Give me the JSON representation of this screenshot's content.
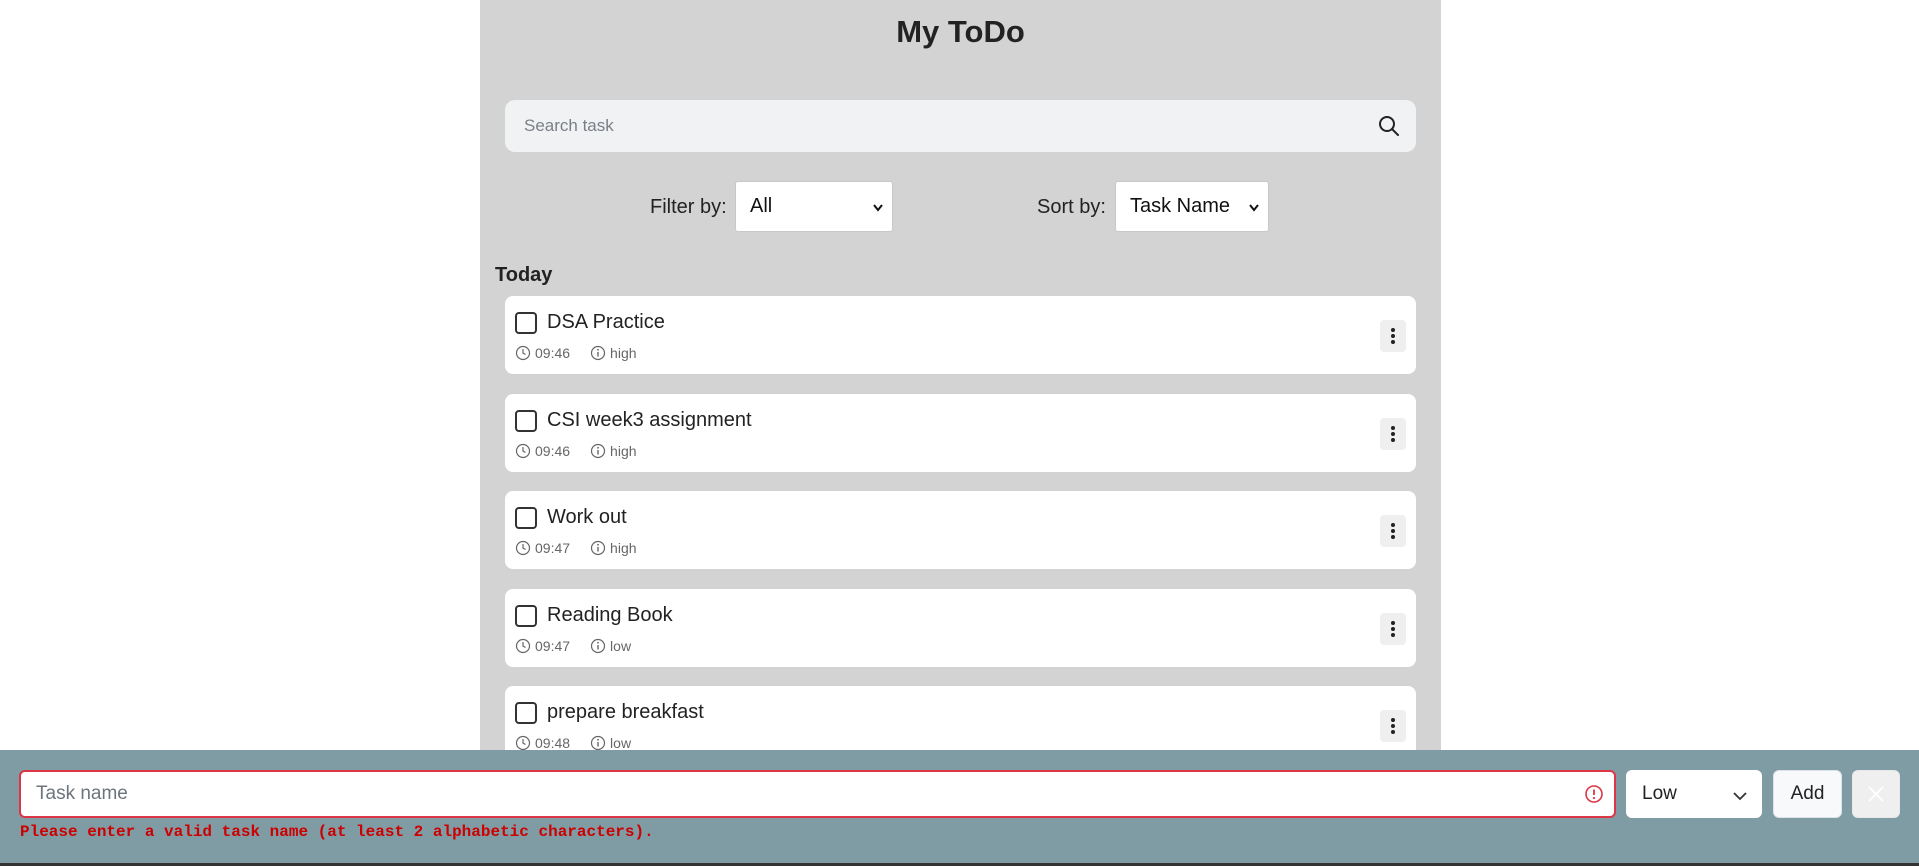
{
  "app": {
    "title": "My ToDo"
  },
  "search": {
    "placeholder": "Search task",
    "value": ""
  },
  "filter": {
    "label": "Filter by:",
    "selected": "All"
  },
  "sort": {
    "label": "Sort by:",
    "selected": "Task Name"
  },
  "group": {
    "label": "Today"
  },
  "tasks": [
    {
      "name": "DSA Practice",
      "time": "09:46",
      "priority": "high"
    },
    {
      "name": "CSI week3 assignment",
      "time": "09:46",
      "priority": "high"
    },
    {
      "name": "Work out",
      "time": "09:47",
      "priority": "high"
    },
    {
      "name": "Reading Book",
      "time": "09:47",
      "priority": "low"
    },
    {
      "name": "prepare breakfast",
      "time": "09:48",
      "priority": "low"
    }
  ],
  "add_form": {
    "placeholder": "Task name",
    "value": "",
    "priority_selected": "Low",
    "add_label": "Add",
    "error": "Please enter a valid task name (at least 2 alphabetic characters)."
  },
  "colors": {
    "panel_bg": "#d3d3d3",
    "bottom_bar_bg": "#7f9ba3",
    "error": "#dc3545"
  }
}
